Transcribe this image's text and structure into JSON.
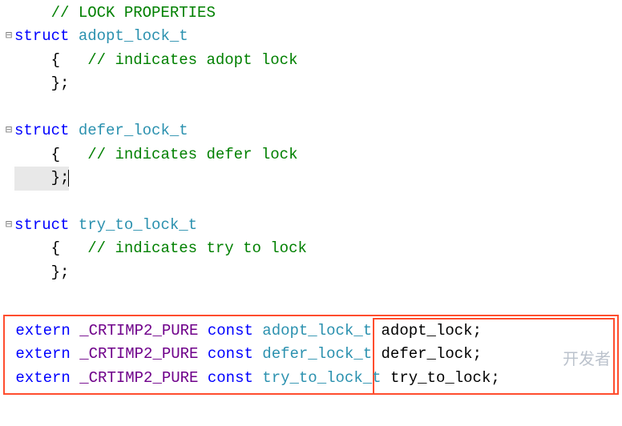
{
  "code": {
    "c1": "// LOCK PROPERTIES",
    "kw_struct": "struct",
    "t_adopt": "adopt_lock_t",
    "c_adopt": "// indicates adopt lock",
    "t_defer": "defer_lock_t",
    "c_defer": "// indicates defer lock",
    "t_try": "try_to_lock_t",
    "c_try": "// indicates try to lock",
    "kw_extern": "extern",
    "macro_pure": "_CRTIMP2_PURE",
    "kw_const": "const",
    "v_adopt": "adopt_lock",
    "v_defer": "defer_lock",
    "v_try": "try_to_lock",
    "brace_open": "{",
    "brace_close_semi": "};",
    "semi": ";"
  },
  "watermark": "开发者",
  "colors": {
    "comment": "#008000",
    "keyword": "#0000ff",
    "type": "#2b91af",
    "macro": "#6f008a",
    "box": "#ff4d2e"
  }
}
